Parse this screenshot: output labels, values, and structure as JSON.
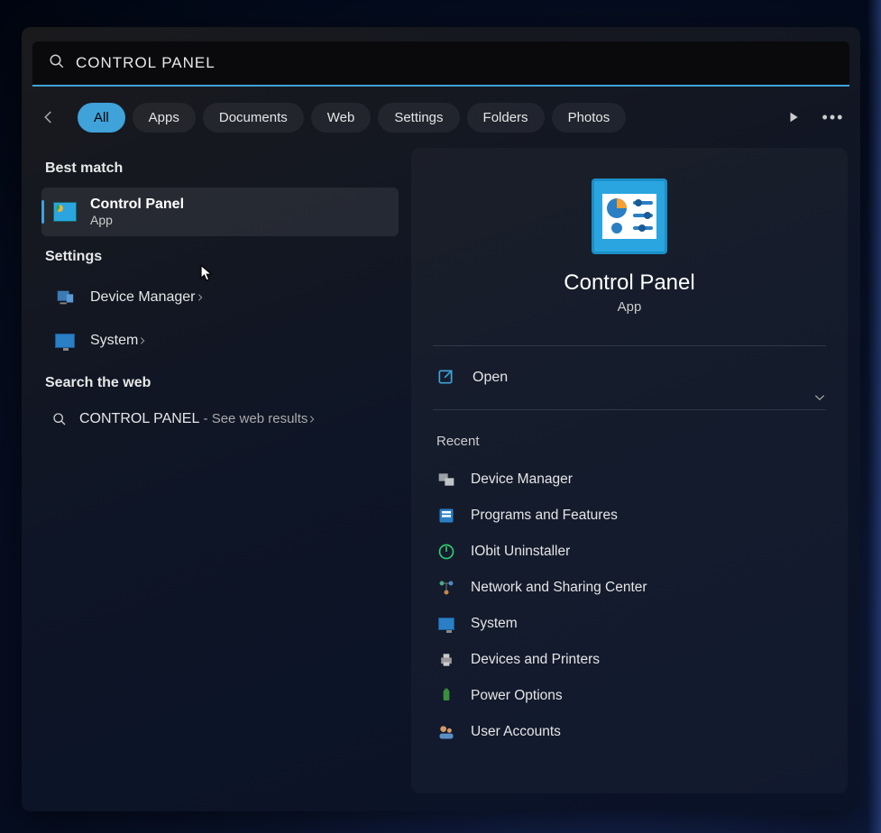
{
  "search": {
    "value": "CONTROL PANEL"
  },
  "filters": {
    "items": [
      "All",
      "Apps",
      "Documents",
      "Web",
      "Settings",
      "Folders",
      "Photos"
    ],
    "active": 0
  },
  "sections": {
    "best_match": "Best match",
    "settings": "Settings",
    "web": "Search the web"
  },
  "best_match_item": {
    "title": "Control Panel",
    "subtitle": "App"
  },
  "settings_items": [
    {
      "label": "Device Manager"
    },
    {
      "label": "System"
    }
  ],
  "web_item": {
    "query": "CONTROL PANEL",
    "suffix": " - See web results"
  },
  "preview": {
    "title": "Control Panel",
    "subtitle": "App",
    "action": "Open",
    "recent_header": "Recent",
    "recent": [
      "Device Manager",
      "Programs and Features",
      "IObit Uninstaller",
      "Network and Sharing Center",
      "System",
      "Devices and Printers",
      "Power Options",
      "User Accounts"
    ]
  }
}
